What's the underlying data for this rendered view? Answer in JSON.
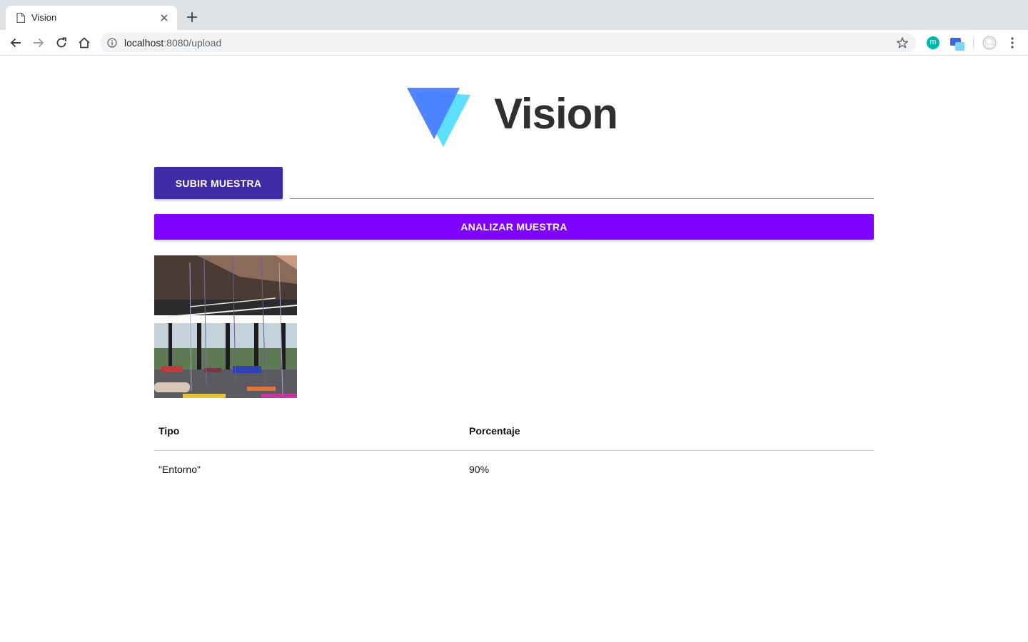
{
  "browser": {
    "tab_title": "Vision",
    "url_host": "localhost",
    "url_rest": ":8080/upload",
    "extension_m_label": "m",
    "icons": [
      "page-icon",
      "close-icon",
      "plus-icon",
      "back-arrow-icon",
      "forward-arrow-icon",
      "reload-icon",
      "home-icon",
      "info-icon",
      "star-icon",
      "avatar-icon",
      "menu-dots-icon"
    ]
  },
  "header": {
    "logo_text": "Vision",
    "logo_colors": [
      "#4a7cff",
      "#5de0ff"
    ]
  },
  "upload": {
    "button_label": "SUBIR MUESTRA",
    "file_value": ""
  },
  "analyze": {
    "button_label": "ANALIZAR MUESTRA"
  },
  "colors": {
    "upload_button": "#3f2ba6",
    "analyze_button": "#8000ff"
  },
  "results": {
    "headers": [
      "Tipo",
      "Porcentaje"
    ],
    "rows": [
      [
        "\"Entorno\"",
        "90%"
      ]
    ]
  }
}
